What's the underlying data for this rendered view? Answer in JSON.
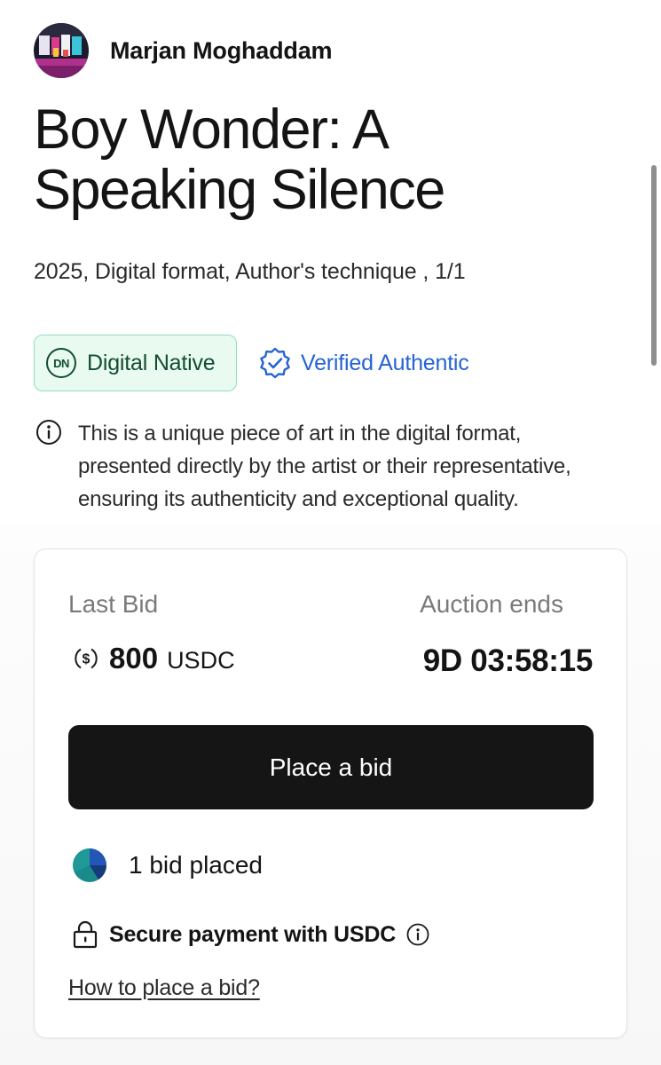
{
  "artist": {
    "name": "Marjan Moghaddam"
  },
  "artwork": {
    "title": "Boy Wonder: A Speaking Silence",
    "meta": "2025, Digital format, Author's technique , 1/1"
  },
  "badges": {
    "digital_native": {
      "abbr": "DN",
      "label": "Digital Native"
    },
    "verified": {
      "label": "Verified Authentic"
    }
  },
  "info": {
    "text": "This is a unique piece of art in the digital format, presented directly by the artist or their representative, ensuring its authenticity and exceptional quality."
  },
  "auction": {
    "last_bid_label": "Last Bid",
    "last_bid_amount": "800",
    "last_bid_currency": "USDC",
    "ends_label": "Auction ends",
    "countdown": "9D 03:58:15",
    "bid_button_label": "Place a bid",
    "bids_count_label": "1 bid placed",
    "secure_label": "Secure payment with USDC",
    "howto_label": "How to place a bid?"
  },
  "icons": {
    "dn": "dn-logo-icon",
    "verified": "badge-check-icon",
    "info": "info-icon",
    "currency": "dollar-circle-icon",
    "bidder": "bidder-avatar-icon",
    "lock": "lock-icon"
  },
  "colors": {
    "digital_native_bg": "#e9fbf1",
    "digital_native_border": "#8fe0b6",
    "digital_native_text": "#124d2e",
    "verified_blue": "#2563d4",
    "button_bg": "#151515"
  }
}
